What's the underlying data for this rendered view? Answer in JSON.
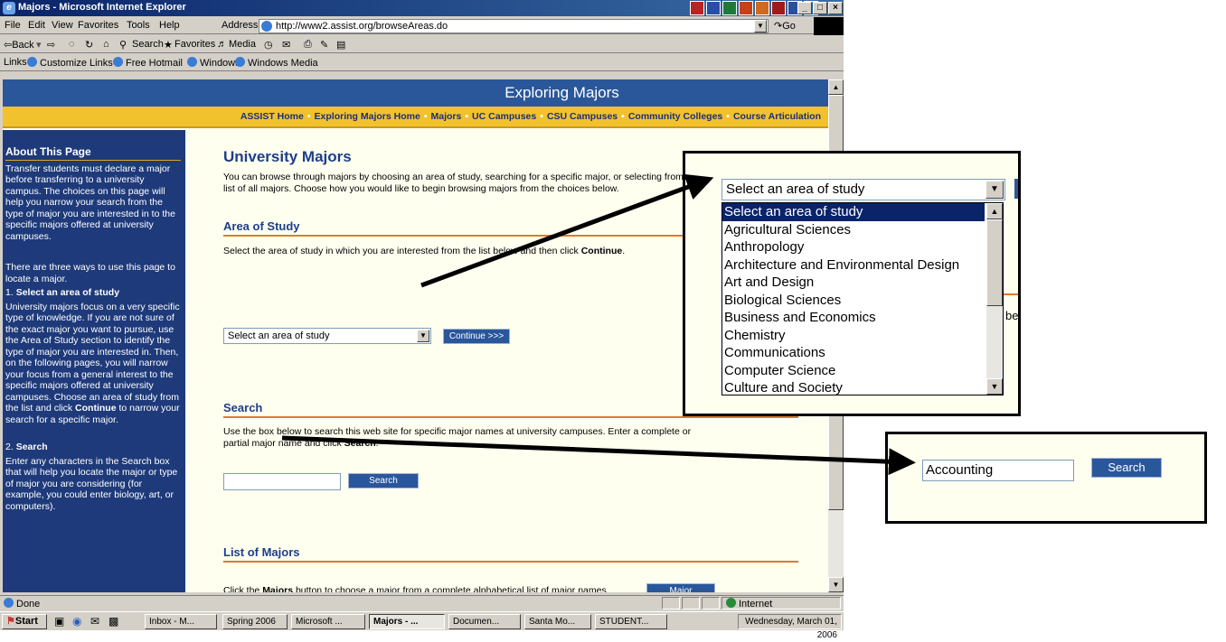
{
  "window": {
    "title": "Majors - Microsoft Internet Explorer",
    "controls": [
      "_",
      "□",
      "×"
    ]
  },
  "menu": [
    "File",
    "Edit",
    "View",
    "Favorites",
    "Tools",
    "Help"
  ],
  "address": {
    "label": "Address",
    "url": "http://www2.assist.org/browseAreas.do",
    "go": "Go"
  },
  "toolbar": {
    "back": "⇦Back",
    "forward": "⇨",
    "search": "Search",
    "favorites": "Favorites",
    "media": "Media"
  },
  "links": {
    "label": "Links",
    "items": [
      "Customize Links",
      "Free Hotmail",
      "Windows",
      "Windows Media"
    ]
  },
  "page": {
    "header": "Exploring Majors",
    "nav": [
      "ASSIST Home",
      "Exploring Majors Home",
      "Majors",
      "UC Campuses",
      "CSU Campuses",
      "Community Colleges",
      "Course Articulation"
    ],
    "nav_separator": "•",
    "sidebar": {
      "heading": "About This Page",
      "p1": "Transfer students must declare a major before transferring to a university campus. The choices on this page will help you narrow your search from the type of major you are interested in to the specific majors offered at university campuses.",
      "p2": "There are three ways to use this page to locate a major.",
      "s1_num": "1. ",
      "s1_title": "Select an area of study",
      "s1_a": "University majors focus on a very specific type of knowledge. If you are not sure of the exact major you want to pursue, use the Area of Study section to identify the type of major you are interested in. Then, on the following pages, you will narrow your focus from a general interest to the specific majors offered at university campuses. Choose an area of study from the list and click ",
      "s1_b": "Continue",
      "s1_c": " to narrow your search for a specific major.",
      "s2_num": "2. ",
      "s2_title": "Search",
      "s2_text": "Enter any characters in the Search box that will help you locate the major or type of major you are considering (for example, you could enter biology, art, or computers)."
    },
    "title": "University Majors",
    "intro": "You can browse through majors by choosing an area of study, searching for a specific major, or selecting from a list of all majors. Choose how you would like to begin browsing majors from the choices below.",
    "area": {
      "heading": "Area of Study",
      "text_a": "Select the area of study in which you are interested from the list below and then click ",
      "text_b": "Continue",
      "text_c": ".",
      "select_value": "Select an area of study",
      "continue": "Continue >>>"
    },
    "search": {
      "heading": "Search",
      "text_a": "Use the box below to search this web site for specific major names at university campuses. Enter a complete or partial major name and click ",
      "text_b": "Search",
      "text_c": ".",
      "button": "Search"
    },
    "list": {
      "heading": "List of Majors",
      "text_a": "Click the ",
      "text_b": "Majors",
      "text_c": " button to choose a major from a complete alphabetical list of major names.",
      "button": "Major"
    }
  },
  "status": {
    "text": "Done",
    "zone": "Internet"
  },
  "taskbar": {
    "start": "Start",
    "tasks": [
      "Inbox - M...",
      "Spring 2006",
      "Microsoft ...",
      "Majors - ...",
      "Documen...",
      "Santa Mo...",
      "STUDENT..."
    ],
    "clock": "Wednesday, March 01, 2006"
  },
  "zoom_select": {
    "value": "Select an area of study",
    "options": [
      "Select an area of study",
      "Agricultural Sciences",
      "Anthropology",
      "Architecture and Environmental Design",
      "Art and Design",
      "Biological Sciences",
      "Business and Economics",
      "Chemistry",
      "Communications",
      "Computer Science",
      "Culture and Society"
    ],
    "cut_fragment": "bec"
  },
  "zoom_search": {
    "input_value": "Accounting",
    "button": "Search"
  }
}
